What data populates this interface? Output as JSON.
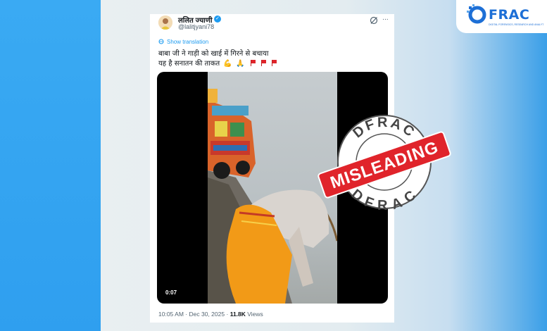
{
  "logo": {
    "text": "FRAC",
    "tagline": "DIGITAL FORENSICS, RESEARCH AND ANALYTICS CENTRE",
    "color": "#1d6fd6"
  },
  "tweet": {
    "display_name": "ललित ज्याणी",
    "handle": "@lalitjyani78",
    "verified": true,
    "show_translation": "Show translation",
    "line1": "बाबा जी ने गाड़ी को खाई में गिरने से बचाया",
    "line2": "यह है सनातन की ताकत",
    "emojis": [
      "muscle-emoji",
      "folded-hands-emoji",
      "red-flag-emoji",
      "red-flag-emoji",
      "red-flag-emoji"
    ],
    "video_timestamp": "0:07",
    "time": "10:05 AM",
    "separator": "·",
    "date": "Dec 30, 2025",
    "views_count": "11.8K",
    "views_label": "Views"
  },
  "stamp": {
    "brand_top": "DFRAC",
    "brand_bottom": "DFRAC",
    "verdict": "MISLEADING",
    "color": "#e0242b"
  },
  "colors": {
    "link": "#1d9bf0",
    "muted": "#536471",
    "left_band": "#3aaaf3"
  }
}
